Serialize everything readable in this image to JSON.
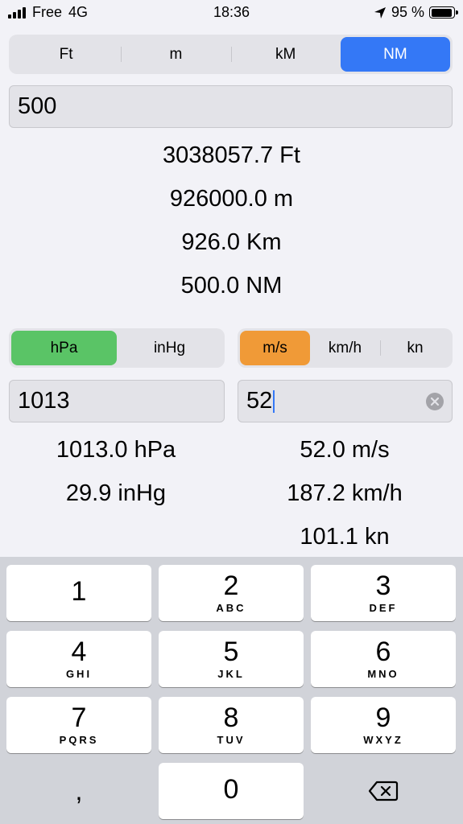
{
  "status": {
    "carrier": "Free",
    "network": "4G",
    "time": "18:36",
    "battery": "95 %"
  },
  "distance": {
    "units": [
      "Ft",
      "m",
      "kM",
      "NM"
    ],
    "selected": "NM",
    "input_value": "500",
    "results": [
      "3038057.7 Ft",
      "926000.0 m",
      "926.0 Km",
      "500.0 NM"
    ]
  },
  "pressure": {
    "units": [
      "hPa",
      "inHg"
    ],
    "selected": "hPa",
    "input_value": "1013",
    "results": [
      "1013.0 hPa",
      "29.9 inHg"
    ]
  },
  "speed": {
    "units": [
      "m/s",
      "km/h",
      "kn"
    ],
    "selected": "m/s",
    "input_value": "52",
    "results": [
      "52.0 m/s",
      "187.2 km/h",
      "101.1 kn"
    ]
  },
  "keyboard": {
    "keys": [
      {
        "num": "1",
        "letters": ""
      },
      {
        "num": "2",
        "letters": "ABC"
      },
      {
        "num": "3",
        "letters": "DEF"
      },
      {
        "num": "4",
        "letters": "GHI"
      },
      {
        "num": "5",
        "letters": "JKL"
      },
      {
        "num": "6",
        "letters": "MNO"
      },
      {
        "num": "7",
        "letters": "PQRS"
      },
      {
        "num": "8",
        "letters": "TUV"
      },
      {
        "num": "9",
        "letters": "WXYZ"
      },
      {
        "num": "0",
        "letters": ""
      }
    ],
    "decimal": ",",
    "delete_icon": "backspace-icon"
  },
  "colors": {
    "blue": "#3478f6",
    "green": "#5ac466",
    "orange": "#f09a37"
  }
}
